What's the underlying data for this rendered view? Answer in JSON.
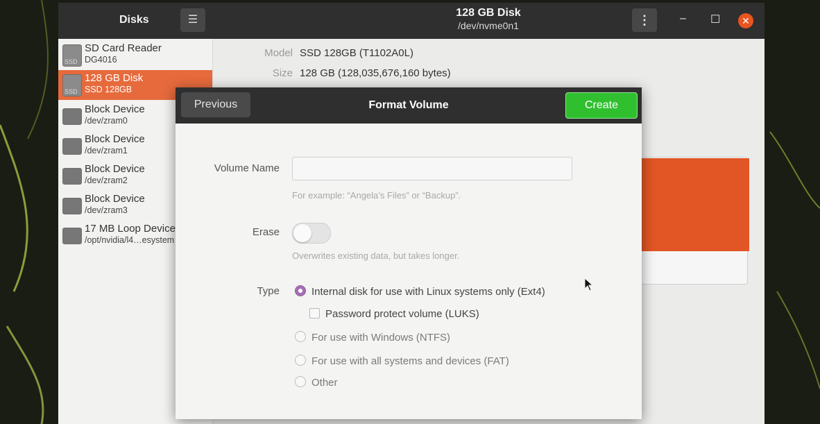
{
  "app": {
    "title": "Disks"
  },
  "header": {
    "disk_title": "128 GB Disk",
    "disk_path": "/dev/nvme0n1",
    "menu_icon": "hamburger-icon",
    "more_icon": "kebab-icon"
  },
  "sidebar": {
    "items": [
      {
        "name": "SD Card Reader",
        "sub": "DG4016",
        "icon": "ssd",
        "icon_label": "SSD",
        "selected": false
      },
      {
        "name": "128 GB Disk",
        "sub": "SSD 128GB",
        "icon": "ssd",
        "icon_label": "SSD",
        "selected": true
      },
      {
        "name": "Block Device",
        "sub": "/dev/zram0",
        "icon": "drive",
        "icon_label": "",
        "selected": false
      },
      {
        "name": "Block Device",
        "sub": "/dev/zram1",
        "icon": "drive",
        "icon_label": "",
        "selected": false
      },
      {
        "name": "Block Device",
        "sub": "/dev/zram2",
        "icon": "drive",
        "icon_label": "",
        "selected": false
      },
      {
        "name": "Block Device",
        "sub": "/dev/zram3",
        "icon": "drive",
        "icon_label": "",
        "selected": false
      },
      {
        "name": "17 MB Loop Device",
        "sub": "/opt/nvidia/l4…esystem",
        "icon": "drive",
        "icon_label": "",
        "selected": false
      }
    ]
  },
  "disk_info": {
    "model_label": "Model",
    "model_value": "SSD 128GB (T1102A0L)",
    "size_label": "Size",
    "size_value": "128 GB (128,035,676,160 bytes)"
  },
  "dialog": {
    "title": "Format Volume",
    "previous_label": "Previous",
    "create_label": "Create",
    "volume_name_label": "Volume Name",
    "volume_name_value": "",
    "volume_name_hint": "For example: “Angela’s Files” or “Backup”.",
    "erase_label": "Erase",
    "erase_on": false,
    "erase_hint": "Overwrites existing data, but takes longer.",
    "type_label": "Type",
    "options": [
      {
        "label": "Internal disk for use with Linux systems only (Ext4)",
        "selected": true
      },
      {
        "label": "Password protect volume (LUKS)",
        "checkbox": true,
        "checked": false
      },
      {
        "label": "For use with Windows (NTFS)",
        "selected": false
      },
      {
        "label": "For use with all systems and devices (FAT)",
        "selected": false
      },
      {
        "label": "Other",
        "selected": false
      }
    ]
  },
  "colors": {
    "accent_orange": "#e95420",
    "create_green": "#2fbf2f",
    "radio_purple": "#a66eb4"
  }
}
